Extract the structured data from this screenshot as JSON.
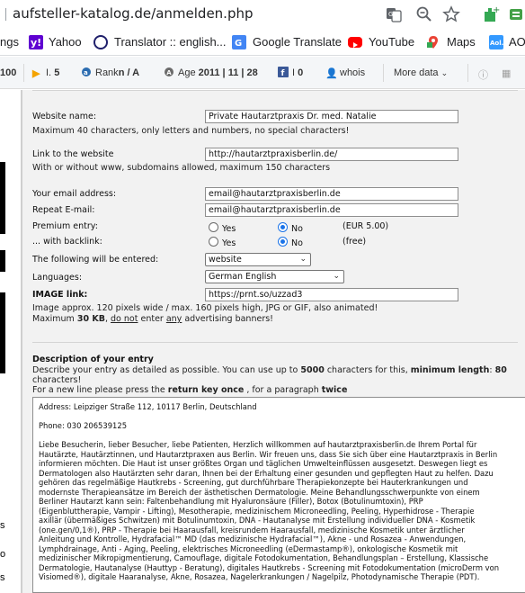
{
  "browser": {
    "url": "aufsteller-katalog.de/anmelden.php",
    "bookmarks": [
      {
        "label": "ngs",
        "icon": "apps-icon"
      },
      {
        "label": "Yahoo",
        "icon": "yahoo-icon",
        "color": "#5f01d1"
      },
      {
        "label": "Translator :: english...",
        "icon": "translator-icon",
        "color": "#1f1f6b"
      },
      {
        "label": "Google Translate",
        "icon": "google-translate-icon",
        "color": "#4285f4"
      },
      {
        "label": "YouTube",
        "icon": "youtube-icon",
        "color": "#ff0000"
      },
      {
        "label": "Maps",
        "icon": "maps-icon",
        "color": "#34a853"
      },
      {
        "label": "AO",
        "icon": "aol-icon",
        "color": "#3399ff"
      }
    ]
  },
  "seo_bar": {
    "items": [
      {
        "label": "100",
        "icon": ""
      },
      {
        "label": "I.",
        "value": "5",
        "icon": "bing-icon"
      },
      {
        "label": "Rank",
        "value": "n / A",
        "icon": "alexa-icon"
      },
      {
        "label": "Age",
        "value": "2011 | 11 | 28",
        "icon": "age-icon"
      },
      {
        "label": "I",
        "value": "0",
        "icon": "facebook-icon"
      },
      {
        "label": "whois",
        "icon": "whois-icon"
      }
    ],
    "more_data": "More data"
  },
  "left_sidebar": {
    "labels": [
      "s",
      "o",
      "s"
    ]
  },
  "form": {
    "website_name_label": "Website name:",
    "website_name_value": "Private Hautarztpraxis Dr. med. Natalie",
    "website_name_hint": "Maximum 40 characters, only letters and numbers, no special characters!",
    "link_label": "Link to the website",
    "link_value": "http://hautarztpraxisberlin.de/",
    "link_hint": "With or without www, subdomains allowed, maximum 150 characters",
    "email_label": "Your email address:",
    "email_value": "email@hautarztpraxisberlin.de",
    "repeat_email_label": "Repeat E-mail:",
    "repeat_email_value": "email@hautarztpraxisberlin.de",
    "premium_label": "Premium entry:",
    "backlink_label": "... with backlink:",
    "yes_label": "Yes",
    "no_label": "No",
    "premium_price": "(EUR 5.00)",
    "backlink_price": "(free)",
    "entered_label": "The following will be entered:",
    "entered_value": "website",
    "languages_label": "Languages:",
    "languages_value": "German English",
    "image_label": "IMAGE link:",
    "image_value": "https://prnt.so/uzzad3",
    "image_hint_1": "Image approx. 120 pixels wide / max. 160 pixels high, JPG or GIF, also animated!",
    "image_hint_2_a": "Maximum ",
    "image_hint_2_b": "30 KB",
    "image_hint_2_c": ", ",
    "image_hint_2_d": "do not",
    "image_hint_2_e": " enter ",
    "image_hint_2_f": "any",
    "image_hint_2_g": " advertising banners!",
    "description_title": "Description of your entry",
    "description_hint_1_a": "Describe your entry as detailed as possible. You can use up to ",
    "description_hint_1_b": "5000",
    "description_hint_1_c": " characters for this, ",
    "description_hint_1_d": "minimum length",
    "description_hint_1_e": ": ",
    "description_hint_1_f": "80",
    "description_hint_2": "characters!",
    "description_hint_3_a": "For a new line please press the ",
    "description_hint_3_b": "return key once",
    "description_hint_3_c": " , for a paragraph ",
    "description_hint_3_d": "twice",
    "description_lines": [
      "Address: Leipziger Straße 112, 10117 Berlin, Deutschland",
      "",
      "Phone: 030 206539125",
      "",
      "Liebe Besucherin, lieber Besucher, liebe Patienten, Herzlich willkommen auf hautarztpraxisberlin.de Ihrem Portal für",
      "Hautärzte, Hautärztinnen, und Hautarztpraxen aus Berlin. Wir freuen uns, dass Sie sich über eine Hautarztpraxis in Berlin",
      "informieren möchten. Die Haut ist unser größtes Organ und täglichen Umwelteinflüssen ausgesetzt. Deswegen liegt es",
      "Dermatologen also Hautärzten sehr daran, Ihnen bei der Erhaltung einer gesunden und gepflegten Haut zu helfen. Dazu",
      "gehören das regelmäßige Hautkrebs - Screening, gut durchführbare Therapiekonzepte bei Hauterkrankungen und",
      "modernste Therapieansätze im Bereich der ästhetischen Dermatologie. Meine Behandlungsschwerpunkte von einem",
      "Berliner Hautarzt kann sein: Faltenbehandlung mit Hyaluronsäure (Filler), Botox (Botulinumtoxin), PRP",
      "(Eigenbluttherapie, Vampir - Lifting), Mesotherapie, medizinischem Microneedling, Peeling, Hyperhidrose - Therapie",
      "axillär (übermäßiges Schwitzen) mit Botulinumtoxin, DNA - Hautanalyse mit Erstellung individueller DNA - Kosmetik",
      "(one.gen/0,1®), PRP - Therapie bei Haarausfall, kreisrundem Haarausfall, medizinische Kosmetik unter ärztlicher",
      "Anleitung und Kontrolle, Hydrafacial™ MD (das medizinische Hydrafacial™), Akne - und Rosazea - Anwendungen,",
      "Lymphdrainage, Anti - Aging, Peeling, elektrisches Microneedling (eDermastamp®), onkologische Kosmetik mit",
      "medizinischer Mikropigmentierung, Camouflage, digitale Fotodokumentation, Behandlungsplan – Erstellung, Klassische",
      "Dermatologie, Hautanalyse (Hauttyp - Beratung), digitales Hautkrebs - Screening mit Fotodokumentation (microDerm von",
      "Visiomed®), digitale Haaranalyse, Akne, Rosazea, Nagelerkrankungen / Nagelpilz, Photodynamische Therapie (PDT)."
    ]
  }
}
